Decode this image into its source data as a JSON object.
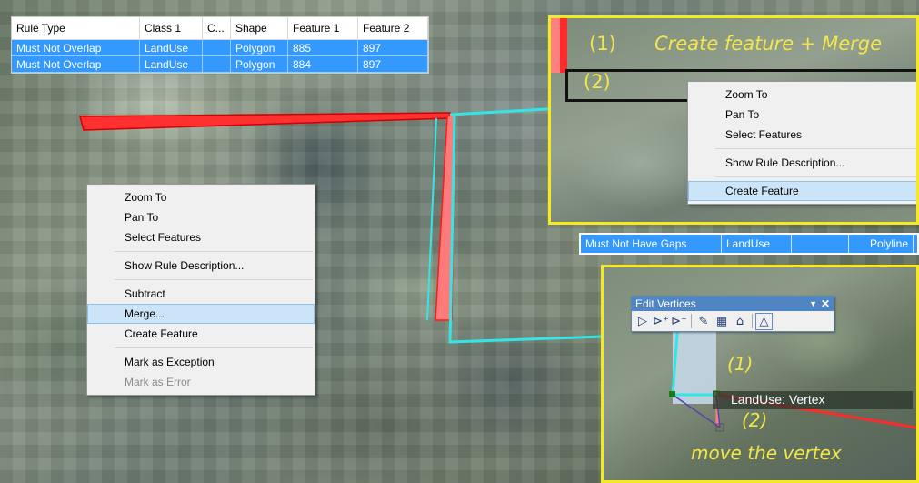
{
  "error_table": {
    "columns": [
      "Rule Type",
      "Class 1",
      "C...",
      "Shape",
      "Feature 1",
      "Feature 2"
    ],
    "rows": [
      [
        "Must Not Overlap",
        "LandUse",
        "",
        "Polygon",
        "885",
        "897"
      ],
      [
        "Must Not Overlap",
        "LandUse",
        "",
        "Polygon",
        "884",
        "897"
      ]
    ]
  },
  "main_menu": {
    "items": [
      "Zoom To",
      "Pan To",
      "Select Features",
      "Show Rule Description...",
      "Subtract",
      "Merge...",
      "Create Feature",
      "Mark as Exception",
      "Mark as Error"
    ],
    "highlighted": "Merge...",
    "disabled": "Mark as Error"
  },
  "inset_top": {
    "label_1": "(1)",
    "label_1_text": "Create feature + Merge",
    "label_2": "(2)",
    "menu_items": [
      "Zoom To",
      "Pan To",
      "Select Features",
      "Show Rule Description...",
      "Create Feature"
    ],
    "highlighted": "Create Feature"
  },
  "gaps_row": [
    "Must Not Have Gaps",
    "LandUse",
    "",
    "Polyline"
  ],
  "inset_bottom": {
    "toolbar_title": "Edit Vertices",
    "toolbar_icons": [
      "select-arrow-icon",
      "add-vertex-icon",
      "delete-vertex-icon",
      "sketch-pencil-icon",
      "trace-icon",
      "reshape-icon",
      "finish-sketch-icon"
    ],
    "label_1": "(1)",
    "label_2": "(2)",
    "vertex_tip": "LandUse: Vertex",
    "caption": "move the vertex"
  },
  "colors": {
    "selection": "#3399ff",
    "highlight": "#cce4f7",
    "annotation_yellow": "#f5ea1f",
    "error_red": "#ff2a2a",
    "boundary_cyan": "#33e6e6"
  }
}
